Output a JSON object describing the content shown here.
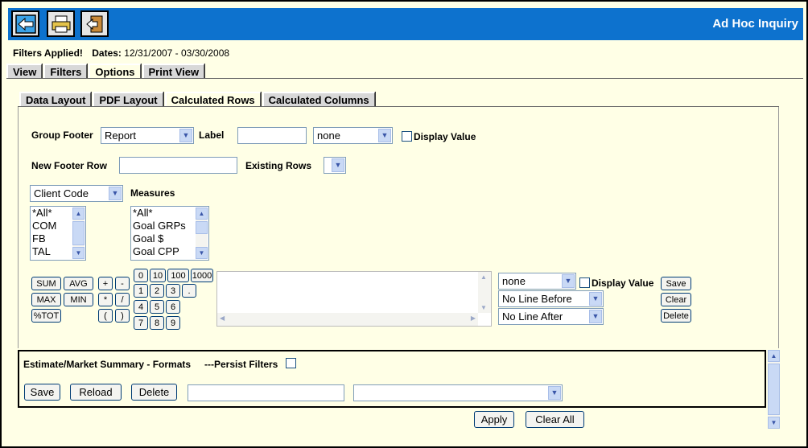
{
  "header": {
    "title": "Ad Hoc Inquiry",
    "buttons": [
      "back-icon",
      "print-icon",
      "exit-icon"
    ]
  },
  "filters": {
    "applied_label": "Filters Applied!",
    "dates_label": "Dates:",
    "dates_value": "12/31/2007 - 03/30/2008"
  },
  "main_tabs": [
    {
      "label": "View"
    },
    {
      "label": "Filters"
    },
    {
      "label": "Options",
      "active": true
    },
    {
      "label": "Print View"
    }
  ],
  "sub_tabs": [
    {
      "label": "Data Layout"
    },
    {
      "label": "PDF Layout"
    },
    {
      "label": "Calculated Rows",
      "active": true
    },
    {
      "label": "Calculated Columns"
    }
  ],
  "group_footer": {
    "label": "Group Footer",
    "value": "Report",
    "label_label": "Label",
    "label_value": "",
    "format_value": "none",
    "display_value_label": "Display Value"
  },
  "new_footer": {
    "label": "New Footer Row",
    "value": "",
    "existing_rows_label": "Existing Rows",
    "existing_rows_value": ""
  },
  "client_code": {
    "value": "Client Code",
    "options": [
      "*All*",
      "COM",
      "FB",
      "TAL"
    ]
  },
  "measures": {
    "label": "Measures",
    "options": [
      "*All*",
      "Goal GRPs",
      "Goal $",
      "Goal CPP"
    ]
  },
  "functions": [
    "SUM",
    "AVG",
    "MAX",
    "MIN",
    "%TOT"
  ],
  "operators": [
    "+",
    "-",
    "*",
    "/",
    "(",
    ")"
  ],
  "numpad": {
    "top": [
      "0",
      "10",
      "100",
      "1000"
    ],
    "rows": [
      [
        "1",
        "2",
        "3",
        "."
      ],
      [
        "4",
        "5",
        "6"
      ],
      [
        "7",
        "8",
        "9"
      ]
    ]
  },
  "row_options": {
    "format_value": "none",
    "display_value_label": "Display Value",
    "line_before": "No Line Before",
    "line_after": "No Line After",
    "save": "Save",
    "clear": "Clear",
    "delete": "Delete"
  },
  "saved_formats": {
    "title": "Estimate/Market Summary - Formats",
    "persist_label": "---Persist Filters",
    "save": "Save",
    "reload": "Reload",
    "delete": "Delete",
    "name_value": "",
    "select_value": ""
  },
  "footer": {
    "apply": "Apply",
    "clear_all": "Clear All"
  }
}
